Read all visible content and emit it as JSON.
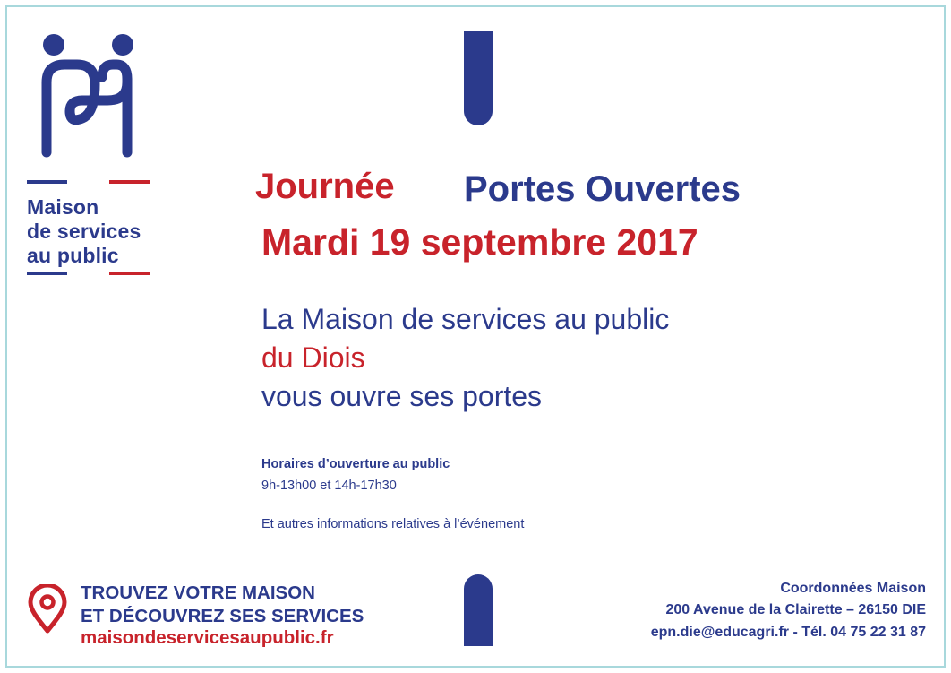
{
  "logo": {
    "name": "Maison de services au public",
    "line1": "Maison",
    "line2": "de services",
    "line3": "au public"
  },
  "title": {
    "word1": "Journée",
    "word2": "Portes Ouvertes",
    "date": "Mardi 19 septembre 2017"
  },
  "intro": {
    "line1": "La Maison de services au public",
    "line2": "du Diois",
    "line3": "vous ouvre ses portes"
  },
  "details": {
    "hours_title": "Horaires d’ouverture au public",
    "hours_value": "9h-13h00 et 14h-17h30",
    "other_info": "Et autres informations relatives à l’événement"
  },
  "footer": {
    "cta_line1": "TROUVEZ VOTRE MAISON",
    "cta_line2": "ET DÉCOUVREZ SES SERVICES",
    "cta_url": "maisondeservicesaupublic.fr",
    "contact_title": "Coordonnées Maison",
    "contact_address": "200 Avenue de la Clairette – 26150 DIE",
    "contact_email_phone": "epn.die@educagri.fr -  Tél. 04 75 22 31 87"
  },
  "icons": {
    "logo": "msap-logo-icon",
    "location": "location-pin-icon"
  },
  "colors": {
    "navy": "#2b3a8c",
    "red": "#c8232b",
    "border": "#a8d8dc"
  }
}
